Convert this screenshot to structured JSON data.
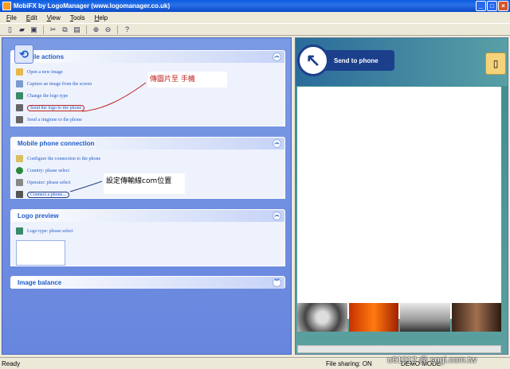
{
  "window": {
    "title": "MobiFX by LogoManager (www.logomanager.co.uk)"
  },
  "menu": [
    "File",
    "Edit",
    "View",
    "Tools",
    "Help"
  ],
  "panels": {
    "file_actions": {
      "title": "File actions",
      "items": [
        "Open a new image",
        "Capture an image from the screen",
        "Change the logo type",
        "Send the logo to the phone",
        "Send a ringtone to the phone"
      ]
    },
    "mobile_connection": {
      "title": "Mobile phone connection",
      "items": [
        "Configure the connection to the phone",
        "Country: please select",
        "Operator: please select",
        "Connect a phone..."
      ]
    },
    "logo_preview": {
      "title": "Logo preview",
      "items": [
        "Logo type: please select"
      ]
    },
    "image_balance": {
      "title": "Image balance"
    }
  },
  "annotations": {
    "send_note": "傳圖片至      手機",
    "connect_note": "設定傳輸線com位置"
  },
  "right_pane": {
    "send_label": "Send to phone"
  },
  "status": {
    "ready": "Ready",
    "file_sharing": "File sharing: ON",
    "mode": "DEMO MODE",
    "watermark": "u61012 @ sogi.com.tw"
  },
  "colors": {
    "panel_bg": "#6786de",
    "panel_title": "#215dc6",
    "status_bg": "#ece9d8"
  }
}
